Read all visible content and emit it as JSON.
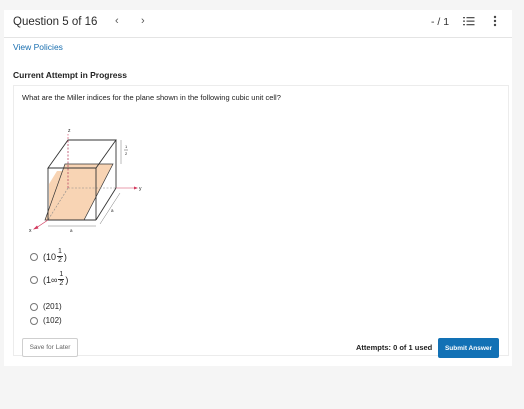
{
  "header": {
    "question_title": "Question 5 of 16",
    "prev_icon": "chevron-left-icon",
    "next_icon": "chevron-right-icon",
    "score": "- / 1",
    "list_icon": "list-icon",
    "more_icon": "more-vertical-icon"
  },
  "links": {
    "view_policies": "View Policies"
  },
  "attempt": {
    "label": "Current Attempt in Progress"
  },
  "question": {
    "text": "What are the Miller indices for the plane shown in the following cubic unit cell?",
    "figure": {
      "z_label": "z",
      "y_label": "y",
      "x_label": "x",
      "a_label": "a",
      "half_num": "1",
      "half_den": "2"
    },
    "options": [
      {
        "prefix": "(10",
        "frac_num": "1",
        "frac_den": "2",
        "suffix": ")"
      },
      {
        "prefix": "(1∞",
        "frac_num": "1",
        "frac_den": "2",
        "suffix": ")"
      },
      {
        "text": "(201)"
      },
      {
        "text": "(102)"
      }
    ]
  },
  "footer": {
    "save_label": "Save for Later",
    "attempts_text": "Attempts: 0 of 1 used",
    "submit_label": "Submit Answer"
  },
  "colors": {
    "accent": "#1271b5",
    "plane_fill": "#f8d4b4",
    "axis_red": "#d33a5e"
  }
}
